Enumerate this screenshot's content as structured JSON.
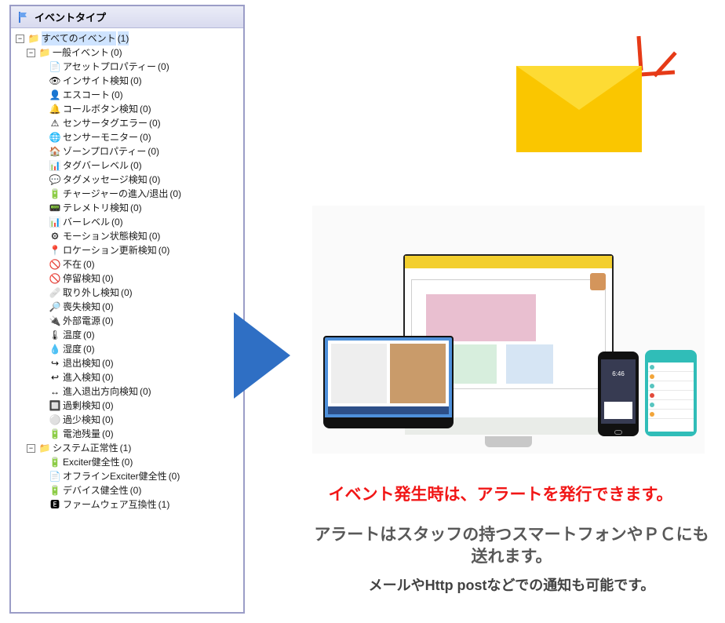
{
  "panel": {
    "title": "イベントタイプ"
  },
  "tree": {
    "root": {
      "label": "すべてのイベント",
      "count": "(1)",
      "icon": "folder"
    },
    "general": {
      "label": "一般イベント",
      "count": "(0)",
      "icon": "folder"
    },
    "general_items": [
      {
        "label": "アセットプロパティー",
        "count": "(0)",
        "icon": "page-icon"
      },
      {
        "label": "インサイト検知",
        "count": "(0)",
        "icon": "eye-icon"
      },
      {
        "label": "エスコート",
        "count": "(0)",
        "icon": "person-icon"
      },
      {
        "label": "コールボタン検知",
        "count": "(0)",
        "icon": "bell-icon"
      },
      {
        "label": "センサータグエラー",
        "count": "(0)",
        "icon": "warn-icon"
      },
      {
        "label": "センサーモニター",
        "count": "(0)",
        "icon": "globe-icon"
      },
      {
        "label": "ゾーンプロパティー",
        "count": "(0)",
        "icon": "home-icon"
      },
      {
        "label": "タグバーレベル",
        "count": "(0)",
        "icon": "chart-icon"
      },
      {
        "label": "タグメッセージ検知",
        "count": "(0)",
        "icon": "msg-icon"
      },
      {
        "label": "チャージャーの進入/退出",
        "count": "(0)",
        "icon": "batt-red-icon"
      },
      {
        "label": "テレメトリ検知",
        "count": "(0)",
        "icon": "dial-icon"
      },
      {
        "label": "バーレベル",
        "count": "(0)",
        "icon": "chart-icon"
      },
      {
        "label": "モーション状態検知",
        "count": "(0)",
        "icon": "move-icon"
      },
      {
        "label": "ロケーション更新検知",
        "count": "(0)",
        "icon": "pin-icon"
      },
      {
        "label": "不在",
        "count": "(0)",
        "icon": "block-icon"
      },
      {
        "label": "停留検知",
        "count": "(0)",
        "icon": "block-icon"
      },
      {
        "label": "取り外し検知",
        "count": "(0)",
        "icon": "remove-icon"
      },
      {
        "label": "喪失検知",
        "count": "(0)",
        "icon": "loss-icon"
      },
      {
        "label": "外部電源",
        "count": "(0)",
        "icon": "plug-icon"
      },
      {
        "label": "温度",
        "count": "(0)",
        "icon": "temp-icon"
      },
      {
        "label": "湿度",
        "count": "(0)",
        "icon": "drop-icon"
      },
      {
        "label": "退出検知",
        "count": "(0)",
        "icon": "exit-icon"
      },
      {
        "label": "進入検知",
        "count": "(0)",
        "icon": "enter-icon"
      },
      {
        "label": "進入退出方向検知",
        "count": "(0)",
        "icon": "dir-icon"
      },
      {
        "label": "過剰検知",
        "count": "(0)",
        "icon": "grid-icon"
      },
      {
        "label": "過少検知",
        "count": "(0)",
        "icon": "dot-icon"
      },
      {
        "label": "電池残量",
        "count": "(0)",
        "icon": "batt-red-icon"
      }
    ],
    "system": {
      "label": "システム正常性",
      "count": "(1)",
      "icon": "folder"
    },
    "system_items": [
      {
        "label": "Exciter健全性",
        "count": "(0)",
        "icon": "batt-red-icon"
      },
      {
        "label": "オフラインExciter健全性",
        "count": "(0)",
        "icon": "page-icon"
      },
      {
        "label": "デバイス健全性",
        "count": "(0)",
        "icon": "batt-red-icon"
      },
      {
        "label": "ファームウェア互換性",
        "count": "(1)",
        "icon": "fw-icon"
      }
    ]
  },
  "phone_time": "6:46",
  "captions": {
    "red": "イベント発生時は、アラートを発行できます。",
    "body1": "アラートはスタッフの持つスマートフォンやＰＣにも送れます。",
    "body2": "メールやHttp postなどでの通知も可能です。"
  },
  "icons": {
    "page-icon": "📄",
    "eye-icon": "👁",
    "person-icon": "👤",
    "bell-icon": "🔔",
    "warn-icon": "⚠",
    "globe-icon": "🌐",
    "home-icon": "🏠",
    "chart-icon": "📊",
    "msg-icon": "💬",
    "batt-red-icon": "🔋",
    "dial-icon": "📟",
    "move-icon": "⚙",
    "pin-icon": "📍",
    "block-icon": "🚫",
    "remove-icon": "🩹",
    "loss-icon": "🔎",
    "plug-icon": "🔌",
    "temp-icon": "🌡",
    "drop-icon": "💧",
    "exit-icon": "↪",
    "enter-icon": "↩",
    "dir-icon": "↔",
    "grid-icon": "🔲",
    "dot-icon": "⚪",
    "fw-icon": "🅴",
    "folder": "📁"
  }
}
